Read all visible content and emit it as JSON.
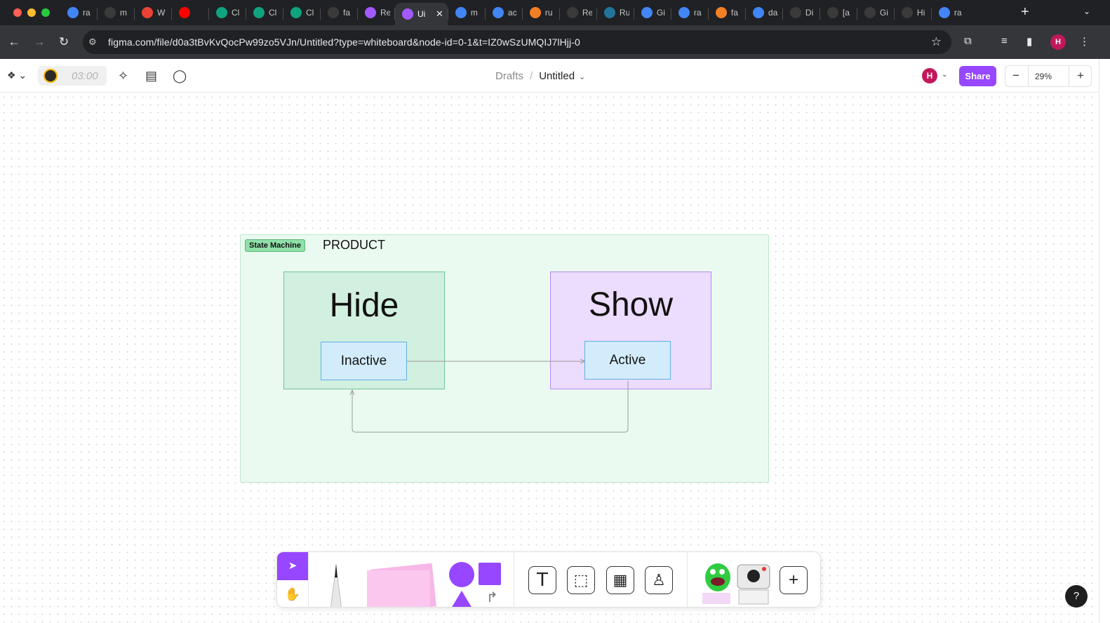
{
  "browser": {
    "tabs": [
      {
        "label": "ra",
        "icon": "google-icon"
      },
      {
        "label": "m",
        "icon": "github-icon"
      },
      {
        "label": "W",
        "icon": "gmail-icon"
      },
      {
        "label": "",
        "icon": "youtube-icon"
      },
      {
        "label": "Cl",
        "icon": "chatgpt-icon"
      },
      {
        "label": "Cl",
        "icon": "chatgpt-icon"
      },
      {
        "label": "Cl",
        "icon": "chatgpt-icon"
      },
      {
        "label": "fa",
        "icon": "github-icon"
      },
      {
        "label": "Re",
        "icon": "figma-icon"
      },
      {
        "label": "Ui",
        "icon": "figma-icon",
        "active": true
      },
      {
        "label": "m",
        "icon": "google-icon"
      },
      {
        "label": "ac",
        "icon": "google-icon"
      },
      {
        "label": "ru",
        "icon": "stackoverflow-icon"
      },
      {
        "label": "Re",
        "icon": "github-icon"
      },
      {
        "label": "Ru",
        "icon": "wordpress-icon"
      },
      {
        "label": "Gi",
        "icon": "translate-icon"
      },
      {
        "label": "ra",
        "icon": "google-icon"
      },
      {
        "label": "fa",
        "icon": "stackoverflow-icon"
      },
      {
        "label": "da",
        "icon": "google-icon"
      },
      {
        "label": "Di",
        "icon": "github-icon"
      },
      {
        "label": "[a",
        "icon": "github-icon"
      },
      {
        "label": "Gi",
        "icon": "github-icon"
      },
      {
        "label": "Hi",
        "icon": "github-icon"
      },
      {
        "label": "ra",
        "icon": "google-icon"
      }
    ],
    "url": "figma.com/file/d0a3tBvKvQocPw99zo5VJn/Untitled?type=whiteboard&node-id=0-1&t=IZ0wSzUMQIJ7lHjj-0",
    "profile_initial": "H"
  },
  "figma": {
    "timer": "03:00",
    "breadcrumb_parent": "Drafts",
    "breadcrumb_sep": "/",
    "file_name": "Untitled",
    "avatar_initial": "H",
    "share_label": "Share",
    "zoom": "29%"
  },
  "board": {
    "section_tag": "State Machine",
    "section_title": "PRODUCT",
    "hide_label": "Hide",
    "show_label": "Show",
    "inactive_label": "Inactive",
    "active_label": "Active",
    "colors": {
      "section_fill": "#ebfaf1",
      "hide_fill": "#d2f0e0",
      "show_fill": "#ecdcfd",
      "state_fill": "#d3ecfc",
      "accent": "#9747ff"
    }
  },
  "help_label": "?"
}
